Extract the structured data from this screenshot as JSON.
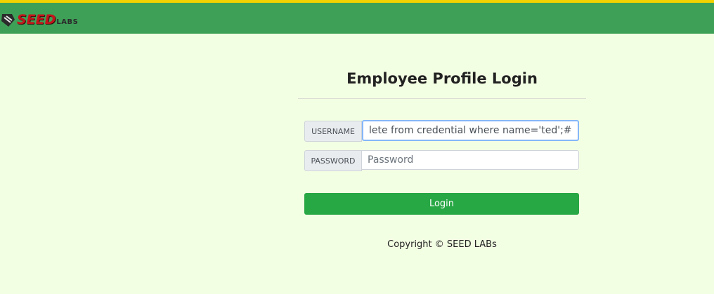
{
  "header": {
    "logo_main": "SEED",
    "logo_sub": "LABS",
    "bar_color": "#3ea057",
    "accent_color": "#f2d200"
  },
  "login": {
    "title": "Employee Profile Login",
    "username_label": "USERNAME",
    "username_value": "lete from credential where name='ted';#",
    "password_label": "PASSWORD",
    "password_placeholder": "Password",
    "login_button": "Login",
    "button_color": "#28a745"
  },
  "footer": {
    "copyright": "Copyright © SEED LABs"
  }
}
